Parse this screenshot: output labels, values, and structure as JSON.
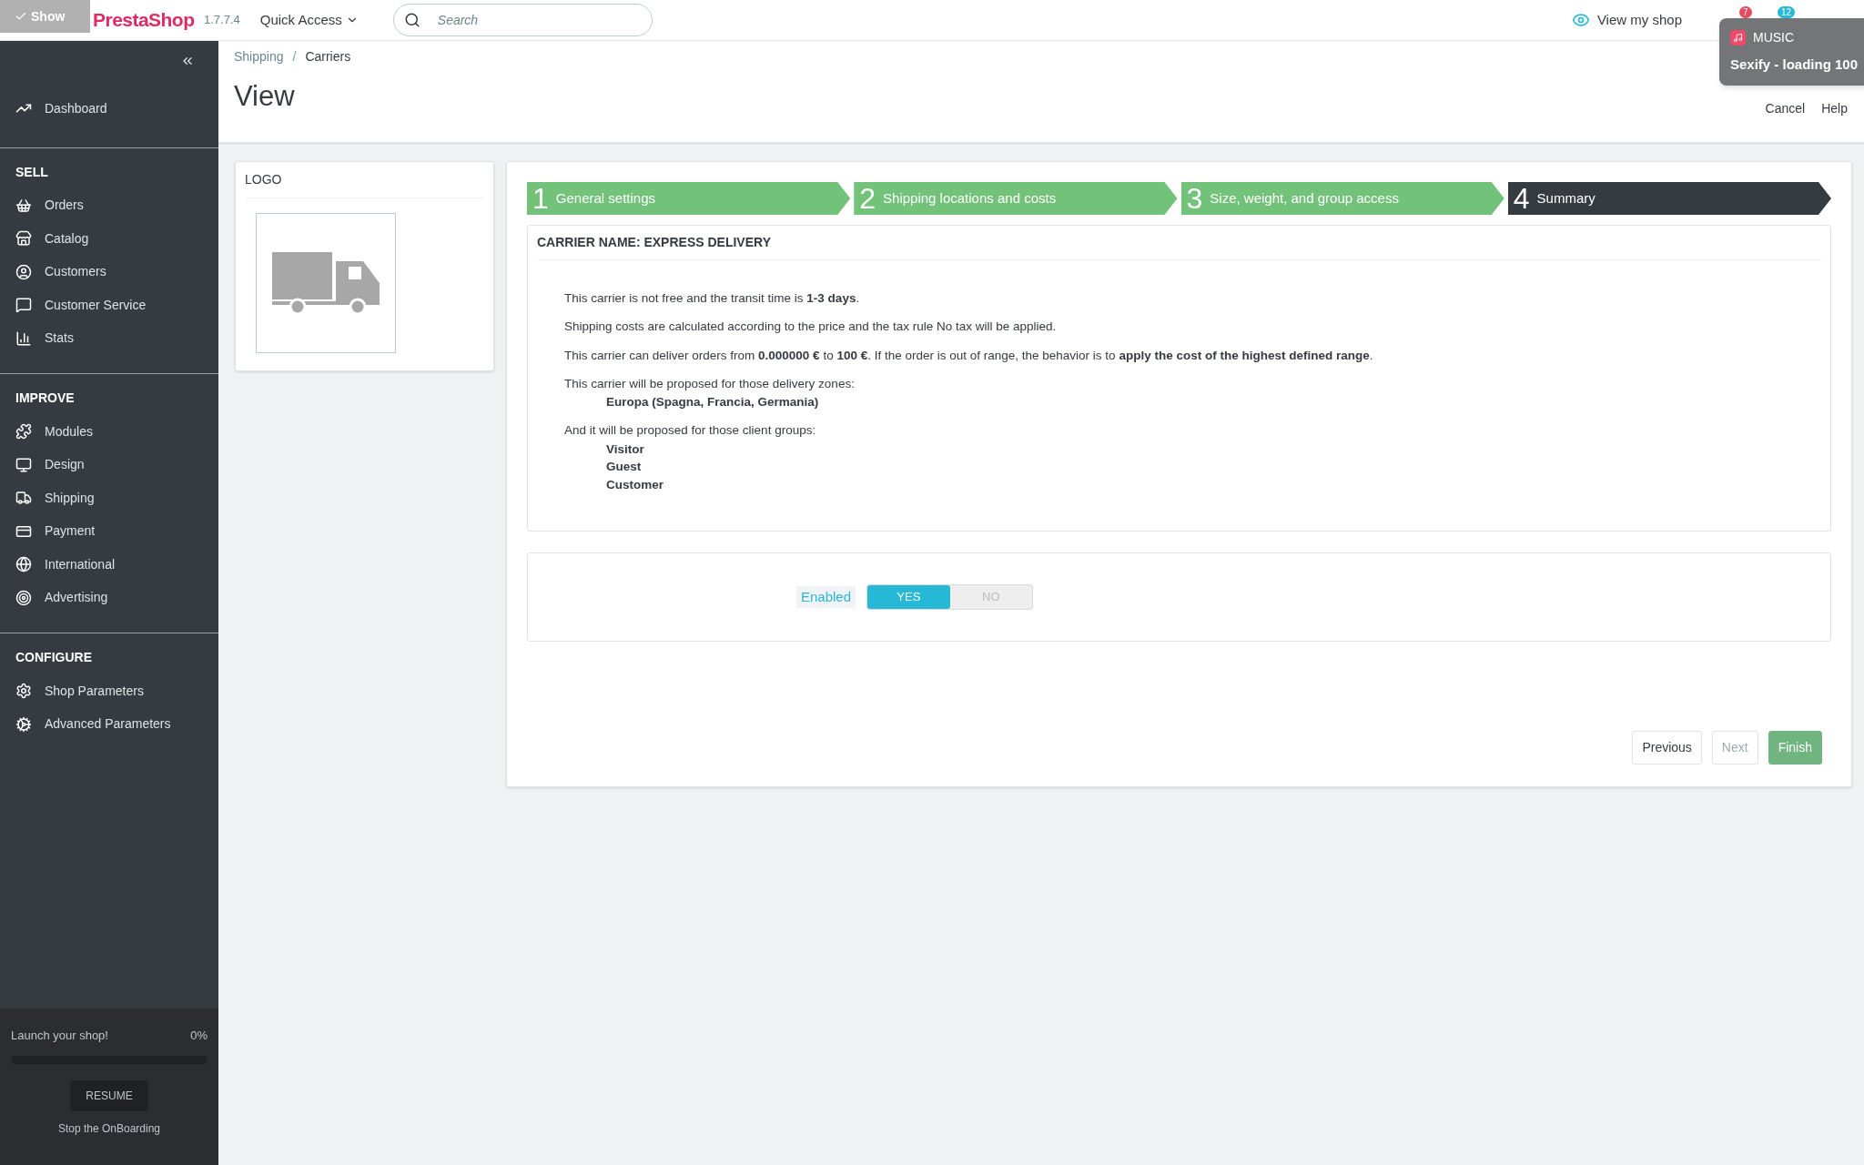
{
  "header": {
    "overlay_label": "Show",
    "logo": "PrestaShop",
    "version": "1.7.7.4",
    "quick_access": "Quick Access",
    "search": {
      "placeholder": "Search"
    },
    "view_shop": "View my shop",
    "badges": [
      "7",
      "12"
    ]
  },
  "notification": {
    "app": "MUSIC",
    "message": "Sexify - loading 100"
  },
  "sidebar": {
    "top_items": [
      "Dashboard"
    ],
    "sections": [
      {
        "title": "SELL",
        "items": [
          "Orders",
          "Catalog",
          "Customers",
          "Customer Service",
          "Stats"
        ]
      },
      {
        "title": "IMPROVE",
        "items": [
          "Modules",
          "Design",
          "Shipping",
          "Payment",
          "International",
          "Advertising"
        ]
      },
      {
        "title": "CONFIGURE",
        "items": [
          "Shop Parameters",
          "Advanced Parameters"
        ]
      }
    ],
    "onboarding": {
      "label": "Launch your shop!",
      "percent": "0%",
      "level": 0,
      "button": "RESUME",
      "stop": "Stop the OnBoarding"
    }
  },
  "breadcrumb": [
    "Shipping",
    "Carriers"
  ],
  "breadcrumb_separator": "/",
  "page_title": "View",
  "toolbar": [
    "Cancel",
    "Help"
  ],
  "logo_panel": {
    "title": "LOGO"
  },
  "steps": [
    {
      "number": "1",
      "label": "General settings",
      "selected": false
    },
    {
      "number": "2",
      "label": "Shipping locations and costs",
      "selected": false
    },
    {
      "number": "3",
      "label": "Size, weight, and group access",
      "selected": false
    },
    {
      "number": "4",
      "label": "Summary",
      "selected": true
    }
  ],
  "summary": {
    "heading": "CARRIER NAME: EXPRESS DELIVERY",
    "lines": [
      "This carrier is not free and the transit time is **1-3 days**.",
      "Shipping costs are calculated according to the price and the tax rule No tax will be applied.",
      "This carrier can deliver orders from **0.000000 €** to **100 €**. If the order is out of range, the behavior is to **apply the cost of the highest defined range**."
    ],
    "zones_intro": "This carrier will be proposed for those delivery zones:",
    "zones": [
      "Europa (Spagna, Francia, Germania)"
    ],
    "groups_intro": "And it will be proposed for those client groups:",
    "groups": [
      "Visitor",
      "Guest",
      "Customer"
    ]
  },
  "enabled": {
    "label": "Enabled",
    "on": true,
    "yes": "YES",
    "no": "NO"
  },
  "buttons": [
    {
      "label": "Previous",
      "kind": "default",
      "disabled": false
    },
    {
      "label": "Next",
      "kind": "default",
      "disabled": true
    },
    {
      "label": "Finish",
      "kind": "primary",
      "disabled": false
    }
  ]
}
